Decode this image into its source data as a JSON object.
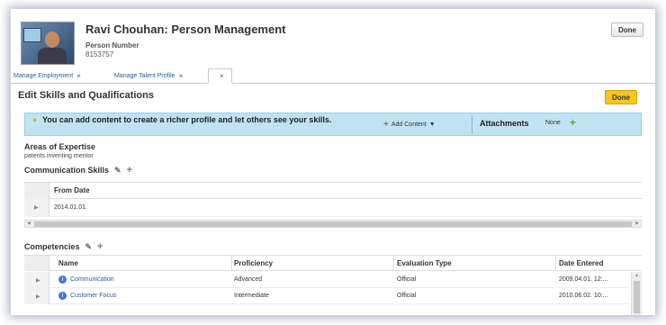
{
  "header": {
    "person_name": "Ravi Chouhan: Person Management",
    "person_number_label": "Person Number",
    "person_number": "8153757",
    "done_label": "Done"
  },
  "tabs": [
    {
      "label": "Manage Employment",
      "close": "×"
    },
    {
      "label": "Manage Talent Profile",
      "close": "×"
    },
    {
      "label": "",
      "close": "×"
    }
  ],
  "page": {
    "title": "Edit Skills and Qualifications",
    "done_label": "Done"
  },
  "infobar": {
    "message": "You can add content to create a richer profile and let others see your skills.",
    "add_content_label": "Add Content",
    "attachments_label": "Attachments",
    "attachments_value": "None"
  },
  "areas_of_expertise": {
    "title": "Areas of Expertise",
    "value": "patents inventing mentor"
  },
  "communication_skills": {
    "title": "Communication Skills",
    "columns": [
      "From Date"
    ],
    "rows": [
      [
        "2014.01.01."
      ]
    ]
  },
  "competencies": {
    "title": "Competencies",
    "columns": [
      "Name",
      "Proficiency",
      "Evaluation Type",
      "Date Entered"
    ],
    "rows": [
      {
        "name": "Communication",
        "proficiency": "Advanced",
        "evaluation_type": "Official",
        "date_entered": "2009.04.01. 12:..."
      },
      {
        "name": "Customer Focus",
        "proficiency": "Intermediate",
        "evaluation_type": "Official",
        "date_entered": "2010.06.02. 10:..."
      }
    ]
  },
  "colors": {
    "accent_done": "#f8c51c",
    "infobar_bg": "#bfe3f3",
    "link": "#1f5f9e",
    "add_green": "#5cae3a"
  }
}
